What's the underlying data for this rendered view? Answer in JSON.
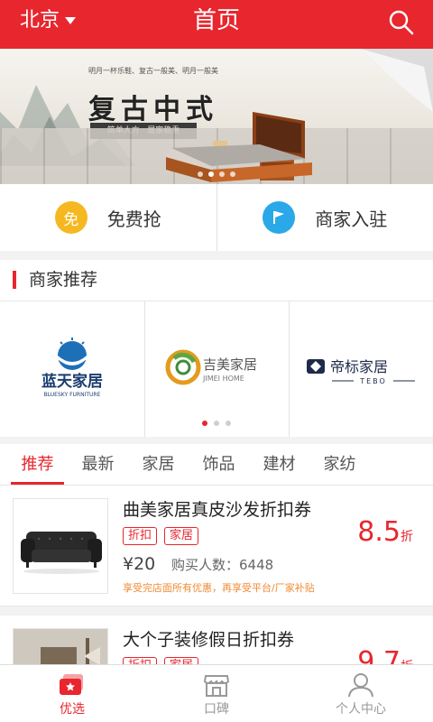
{
  "header": {
    "city": "北京",
    "title": "首页",
    "search_icon": "search-icon"
  },
  "banner": {
    "headline": "复古中式",
    "subline": "简单大方 · 居家稳重",
    "small_text": "明月一杯乐鞋、复古一般美、明月一般美",
    "slide_count": 4,
    "active_slide": 2
  },
  "quick_actions": [
    {
      "icon_char": "免",
      "label": "免费抢",
      "color": "#f5b820"
    },
    {
      "label": "商家入驻",
      "color": "#2aa8e8",
      "icon": "flag-icon"
    }
  ],
  "merchants": {
    "section_title": "商家推荐",
    "items": [
      {
        "name_cn": "蓝天家居",
        "name_en": "BLUESKY FURNITURE"
      },
      {
        "name_cn": "吉美家居",
        "name_en": "JIMEI HOME"
      },
      {
        "name_cn": "帝标家居",
        "name_en": "TEBO"
      }
    ],
    "page_count": 3,
    "active_page": 0
  },
  "tabs": [
    "推荐",
    "最新",
    "家居",
    "饰品",
    "建材",
    "家纺"
  ],
  "active_tab": 0,
  "deals": [
    {
      "title": "曲美家居真皮沙发折扣券",
      "tags": [
        "折扣",
        "家居"
      ],
      "price": "¥20",
      "buyers": "购买人数：6448",
      "note": "享受完店面所有优惠，再享受平台/厂家补贴",
      "discount": "8.5",
      "discount_unit": "折"
    },
    {
      "title": "大个子装修假日折扣券",
      "tags": [
        "折扣",
        "家居"
      ],
      "price": "",
      "buyers": "",
      "note": "",
      "discount": "9.7",
      "discount_unit": "折"
    }
  ],
  "tabbar": [
    {
      "label": "优选",
      "icon": "ticket-icon",
      "active": true
    },
    {
      "label": "口碑",
      "icon": "storefront-icon",
      "active": false
    },
    {
      "label": "个人中心",
      "icon": "person-icon",
      "active": false
    }
  ],
  "colors": {
    "primary": "#e8262d",
    "note": "#f08b34",
    "yellow": "#f5b820",
    "blue": "#2aa8e8"
  }
}
